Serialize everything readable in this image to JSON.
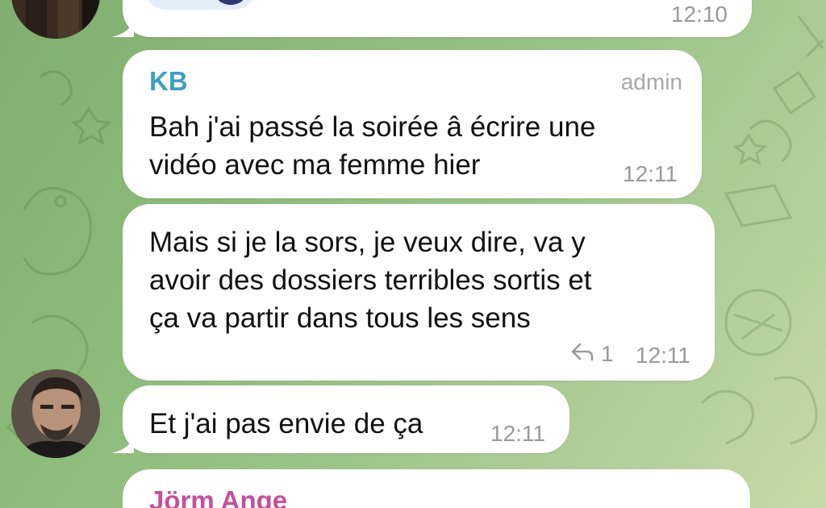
{
  "colors": {
    "kb_name": "#3d9fc3",
    "jorm_name": "#c4509a",
    "bubble": "#ffffff",
    "meta_text": "#9a9a9a"
  },
  "messages": [
    {
      "time": "12:10",
      "reaction_icon": "heart-icon"
    },
    {
      "sender": "KB",
      "role": "admin",
      "text_lines": [
        "Bah j'ai passé la soirée â écrire une",
        "vidéo avec ma femme hier"
      ],
      "time": "12:11"
    },
    {
      "text_lines": [
        "Mais si je la sors, je veux dire, va y",
        "avoir des dossiers terribles sortis et",
        "ça va partir dans tous les sens"
      ],
      "replies": "1",
      "time": "12:11",
      "reply_icon": "reply-arrow-icon"
    },
    {
      "text_lines": [
        "Et j'ai pas envie de ça"
      ],
      "time": "12:11"
    },
    {
      "sender": "Jörm Ange"
    }
  ]
}
